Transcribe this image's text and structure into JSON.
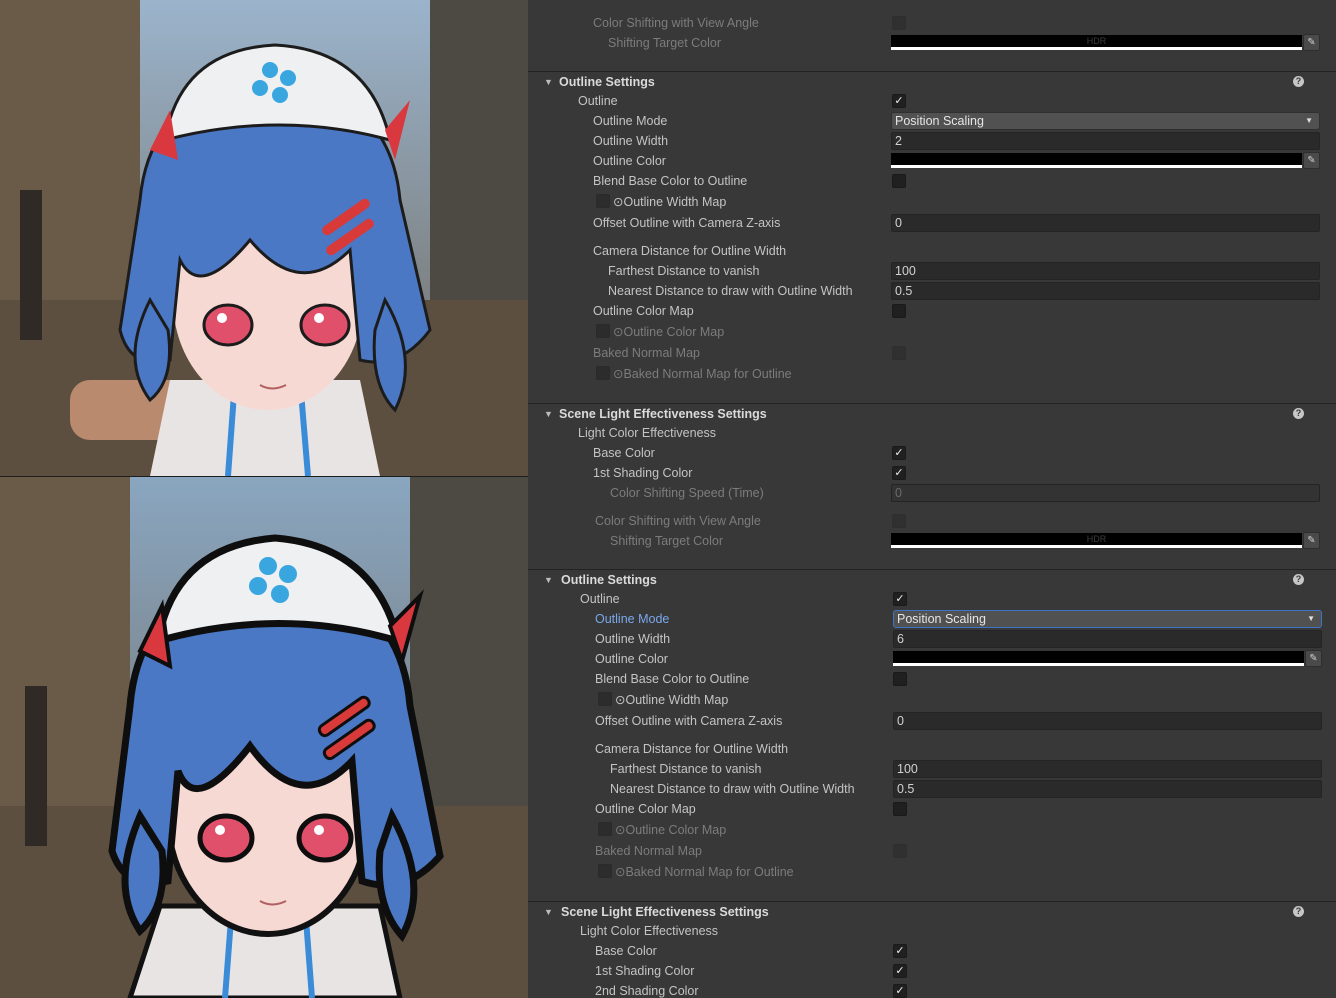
{
  "top": {
    "partial": {
      "color_shifting_label": "Color Shifting with View Angle",
      "shifting_target_label": "Shifting Target Color",
      "hdr_text": "HDR"
    },
    "outline": {
      "title": "Outline Settings",
      "help": "?",
      "outline_label": "Outline",
      "mode_label": "Outline Mode",
      "mode_value": "Position Scaling",
      "width_label": "Outline Width",
      "width_value": "2",
      "color_label": "Outline Color",
      "blend_label": "Blend Base Color to Outline",
      "width_map_label": "⊙Outline Width Map",
      "offset_label": "Offset Outline with Camera Z-axis",
      "offset_value": "0",
      "cam_dist_label": "Camera Distance for Outline Width",
      "farthest_label": "Farthest Distance to vanish",
      "farthest_value": "100",
      "nearest_label": "Nearest Distance to draw with Outline Width",
      "nearest_value": "0.5",
      "color_map_label": "Outline Color Map",
      "color_map_tex_label": "⊙Outline Color Map",
      "baked_label": "Baked Normal Map",
      "baked_tex_label": "⊙Baked Normal Map for Outline"
    },
    "scene": {
      "title": "Scene Light Effectiveness Settings",
      "help": "?",
      "light_label": "Light Color Effectiveness",
      "base_label": "Base Color",
      "first_shading_label": "1st Shading Color"
    }
  },
  "bottom": {
    "partial": {
      "speed_label": "Color Shifting Speed (Time)",
      "speed_value": "0",
      "color_shifting_label": "Color Shifting with View Angle",
      "shifting_target_label": "Shifting Target Color",
      "hdr_text": "HDR"
    },
    "outline": {
      "title": "Outline Settings",
      "help": "?",
      "outline_label": "Outline",
      "mode_label": "Outline Mode",
      "mode_value": "Position Scaling",
      "width_label": "Outline Width",
      "width_value": "6",
      "color_label": "Outline Color",
      "blend_label": "Blend Base Color to Outline",
      "width_map_label": "⊙Outline Width Map",
      "offset_label": "Offset Outline with Camera Z-axis",
      "offset_value": "0",
      "cam_dist_label": "Camera Distance for Outline Width",
      "farthest_label": "Farthest Distance to vanish",
      "farthest_value": "100",
      "nearest_label": "Nearest Distance to draw with Outline Width",
      "nearest_value": "0.5",
      "color_map_label": "Outline Color Map",
      "color_map_tex_label": "⊙Outline Color Map",
      "baked_label": "Baked Normal Map",
      "baked_tex_label": "⊙Baked Normal Map for Outline"
    },
    "scene": {
      "title": "Scene Light Effectiveness Settings",
      "help": "?",
      "light_label": "Light Color Effectiveness",
      "base_label": "Base Color",
      "first_shading_label": "1st Shading Color",
      "second_shading_label": "2nd Shading Color"
    }
  },
  "icons": {
    "expand": "▼",
    "check": "✓",
    "caret": "▼",
    "eyedropper": "✎"
  },
  "colors": {
    "hair": "#4a78c4",
    "eyes": "#e0506a",
    "background": "#7d6a55"
  }
}
